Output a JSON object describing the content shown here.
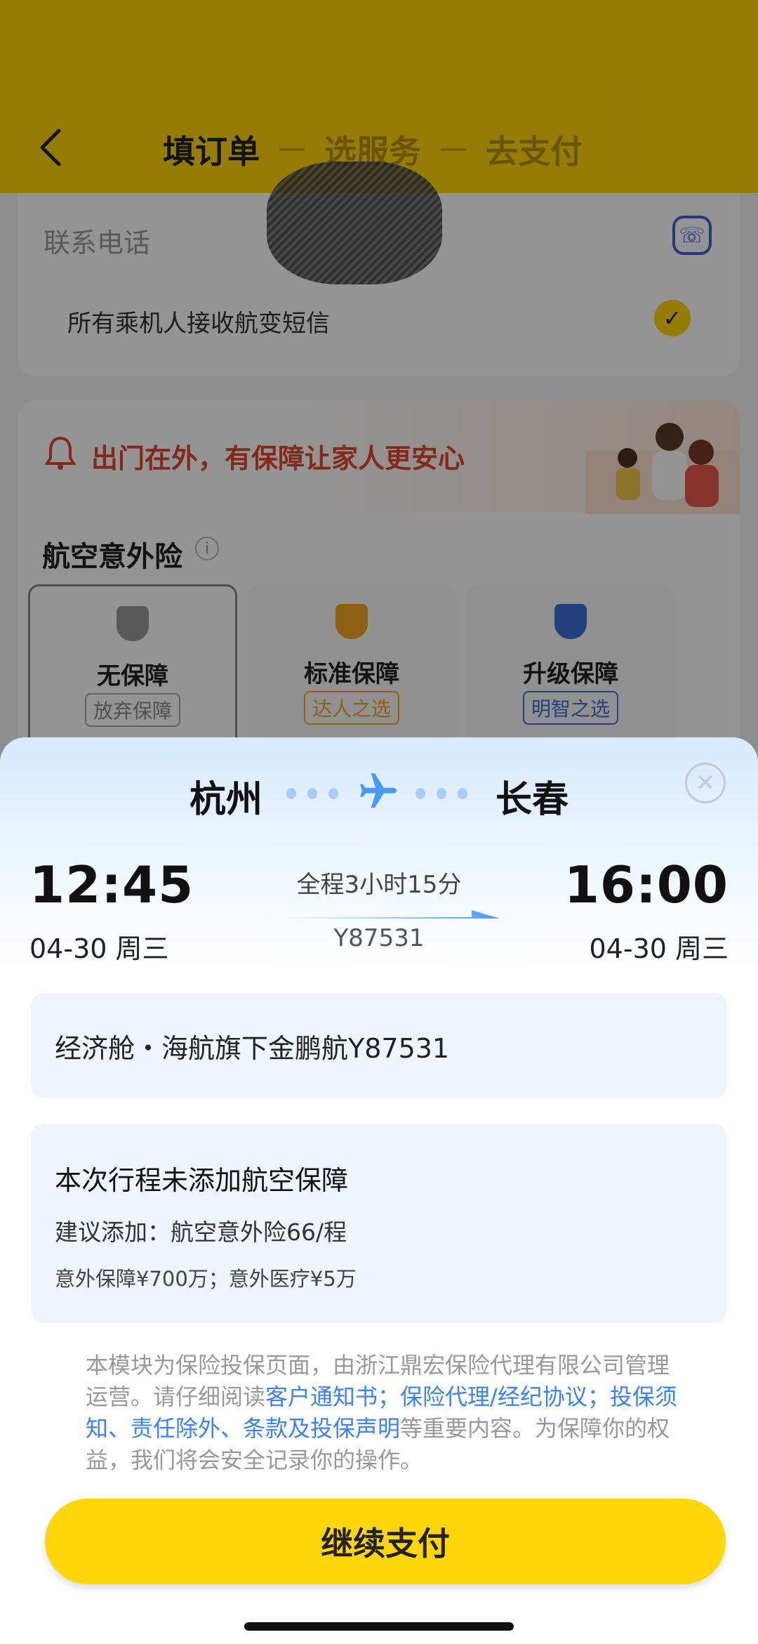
{
  "header": {
    "steps": [
      "填订单",
      "选服务",
      "去支付"
    ]
  },
  "contact": {
    "label": "联系电话",
    "sms_label": "所有乘机人接收航变短信"
  },
  "insurance": {
    "promo": "出门在外，有保障让家人更安心",
    "title": "航空意外险",
    "plans": [
      {
        "name": "无保障",
        "tag": "放弃保障",
        "color": "#888888"
      },
      {
        "name": "标准保障",
        "tag": "达人之选",
        "color": "#f5a623"
      },
      {
        "name": "升级保障",
        "tag": "明智之选",
        "color": "#3b6fd8"
      }
    ]
  },
  "sheet": {
    "from_city": "杭州",
    "to_city": "长春",
    "dep_time": "12:45",
    "arr_time": "16:00",
    "dep_date": "04-30 周三",
    "arr_date": "04-30 周三",
    "duration": "全程3小时15分",
    "flight_no": "Y87531",
    "cabin_info": "经济舱・海航旗下金鹏航Y87531",
    "no_cover_title": "本次行程未添加航空保障",
    "suggest": "建议添加：航空意外险66/程",
    "coverage": "意外保障¥700万；意外医疗¥5万",
    "disclaimer": {
      "part1": "本模块为保险投保页面，由浙江鼎宏保险代理有限公司管理运营。请仔细阅读",
      "link1": "客户通知书",
      "sep1": "；",
      "link2": "保险代理/经纪协议",
      "sep2": "；",
      "link3": "投保须知、责任除外、条款及投保声明",
      "part2": "等重要内容。为保障你的权益，我们将会安全记录你的操作。"
    },
    "pay_button": "继续支付"
  },
  "colors": {
    "brand_yellow": "#ffd60a",
    "link_blue": "#3b82f6",
    "alert_red": "#e0482e"
  }
}
